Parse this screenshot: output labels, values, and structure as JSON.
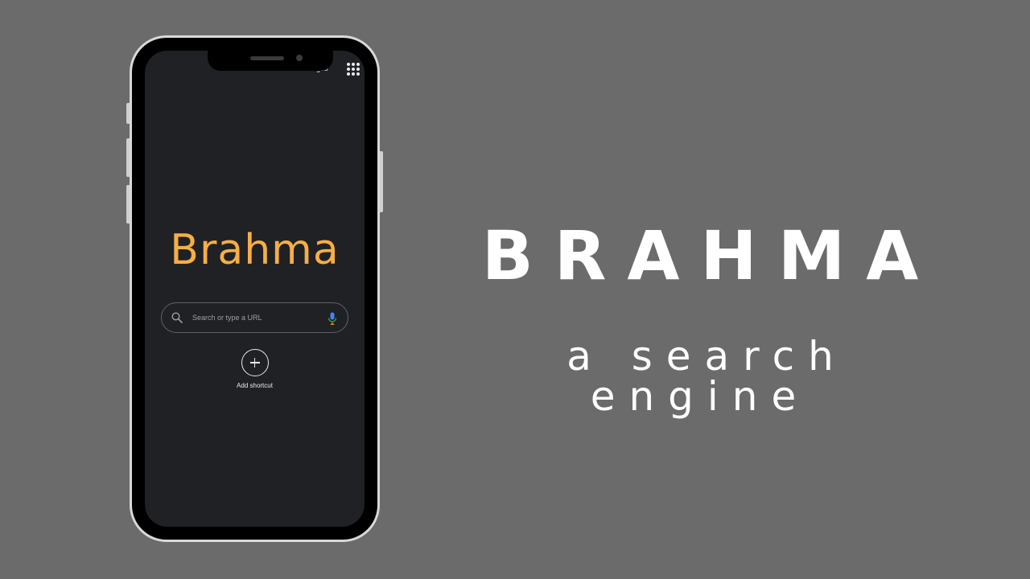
{
  "phone": {
    "top_links": {
      "gmail": "Gmail",
      "images": "Images"
    },
    "logo_text": "Brahma",
    "search": {
      "placeholder": "Search or type a URL"
    },
    "shortcut": {
      "label": "Add shortcut"
    }
  },
  "promo": {
    "headline": "BRAHMA",
    "tagline": "a search engine"
  },
  "colors": {
    "background": "#6b6b6b",
    "screen": "#202124",
    "logo": "#f6ae46",
    "text": "#ffffff"
  },
  "icons": {
    "apps": "apps-grid-icon",
    "search": "search-icon",
    "mic": "mic-icon",
    "add": "plus-icon"
  }
}
